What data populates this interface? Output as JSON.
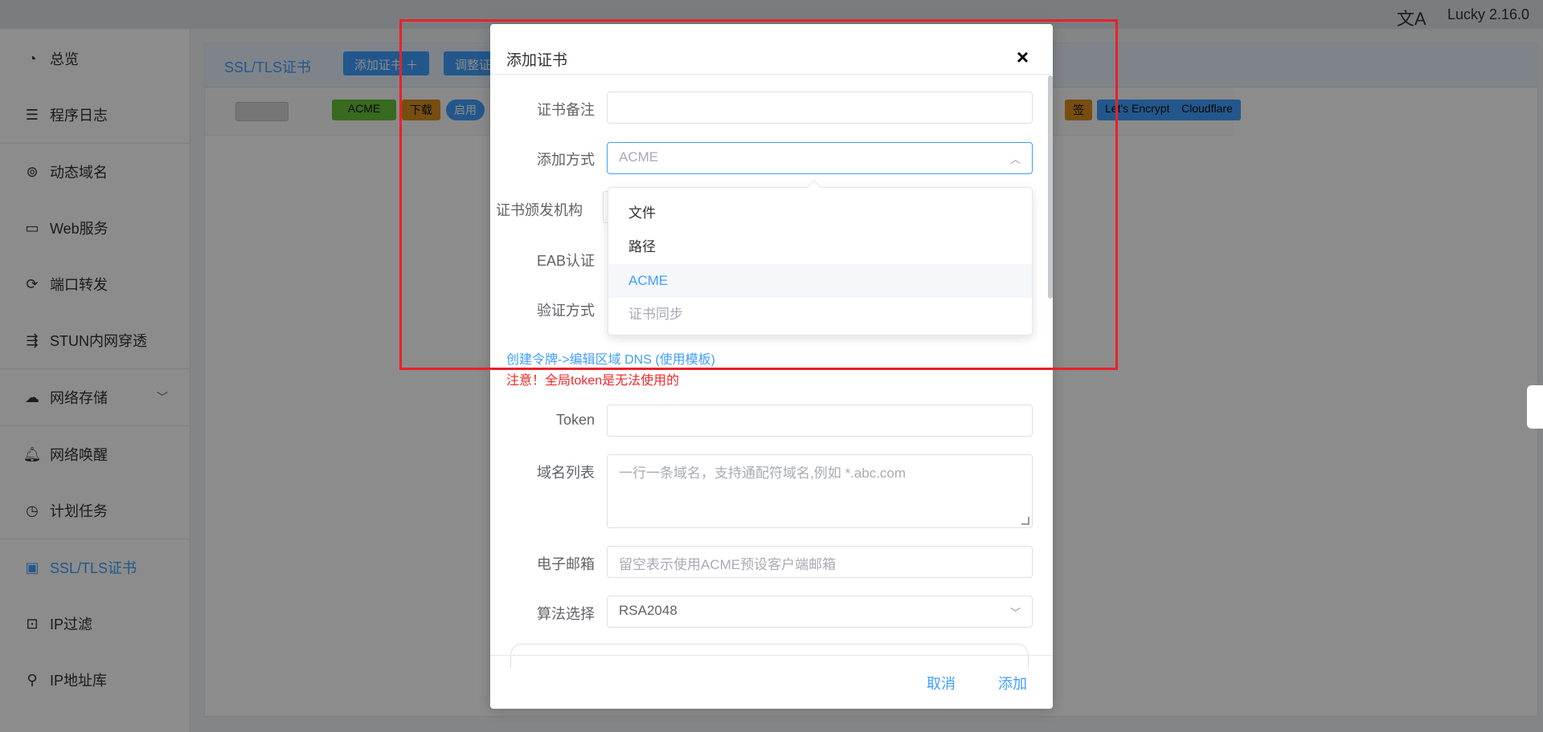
{
  "topbar": {
    "translate_icon": "translate-icon",
    "version": "Lucky 2.16.0"
  },
  "sidebar": {
    "items": [
      {
        "label": "总览",
        "icon": "dashboard-icon"
      },
      {
        "label": "程序日志",
        "icon": "log-icon"
      },
      {
        "label": "动态域名",
        "icon": "dns-icon"
      },
      {
        "label": "Web服务",
        "icon": "web-icon"
      },
      {
        "label": "端口转发",
        "icon": "port-forward-icon"
      },
      {
        "label": "STUN内网穿透",
        "icon": "stun-icon"
      },
      {
        "label": "网络存储",
        "icon": "cloud-icon"
      },
      {
        "label": "网络唤醒",
        "icon": "bell-icon"
      },
      {
        "label": "计划任务",
        "icon": "clock-icon"
      },
      {
        "label": "SSL/TLS证书",
        "icon": "certificate-icon"
      },
      {
        "label": "IP过滤",
        "icon": "ip-filter-icon"
      },
      {
        "label": "IP地址库",
        "icon": "ip-library-icon"
      }
    ],
    "active_index": 9
  },
  "main": {
    "title": "SSL/TLS证书",
    "add_button": "添加证书 ＋",
    "adjust_button": "调整证",
    "row_tags": {
      "acme": "ACME",
      "download": "下载",
      "enable": "启用",
      "sign": "签",
      "letsencrypt": "Let's Encrypt",
      "cloudflare": "Cloudflare"
    }
  },
  "dialog": {
    "title": "添加证书",
    "close": "×",
    "fields": {
      "remark": {
        "label": "证书备注",
        "value": ""
      },
      "method": {
        "label": "添加方式",
        "value": "ACME"
      },
      "ca": {
        "label": "证书颁发机构"
      },
      "eab": {
        "label": "EAB认证"
      },
      "verify": {
        "label": "验证方式"
      },
      "token": {
        "label": "Token",
        "value": ""
      },
      "domains": {
        "label": "域名列表",
        "placeholder": "一行一条域名，支持通配符域名,例如 *.abc.com"
      },
      "email": {
        "label": "电子邮箱",
        "placeholder": "留空表示使用ACME预设客户端邮箱"
      },
      "algorithm": {
        "label": "算法选择",
        "value": "RSA2048"
      }
    },
    "link": "创建令牌->编辑区域 DNS (使用模板)",
    "warning": "注意！全局token是无法使用的",
    "cancel": "取消",
    "submit": "添加"
  },
  "dropdown": {
    "options": [
      {
        "label": "文件",
        "state": "normal"
      },
      {
        "label": "路径",
        "state": "normal"
      },
      {
        "label": "ACME",
        "state": "selected"
      },
      {
        "label": "证书同步",
        "state": "disabled"
      }
    ]
  },
  "colors": {
    "accent": "#409eff",
    "warning": "#f02828",
    "highlight_box": "#e8212b"
  }
}
